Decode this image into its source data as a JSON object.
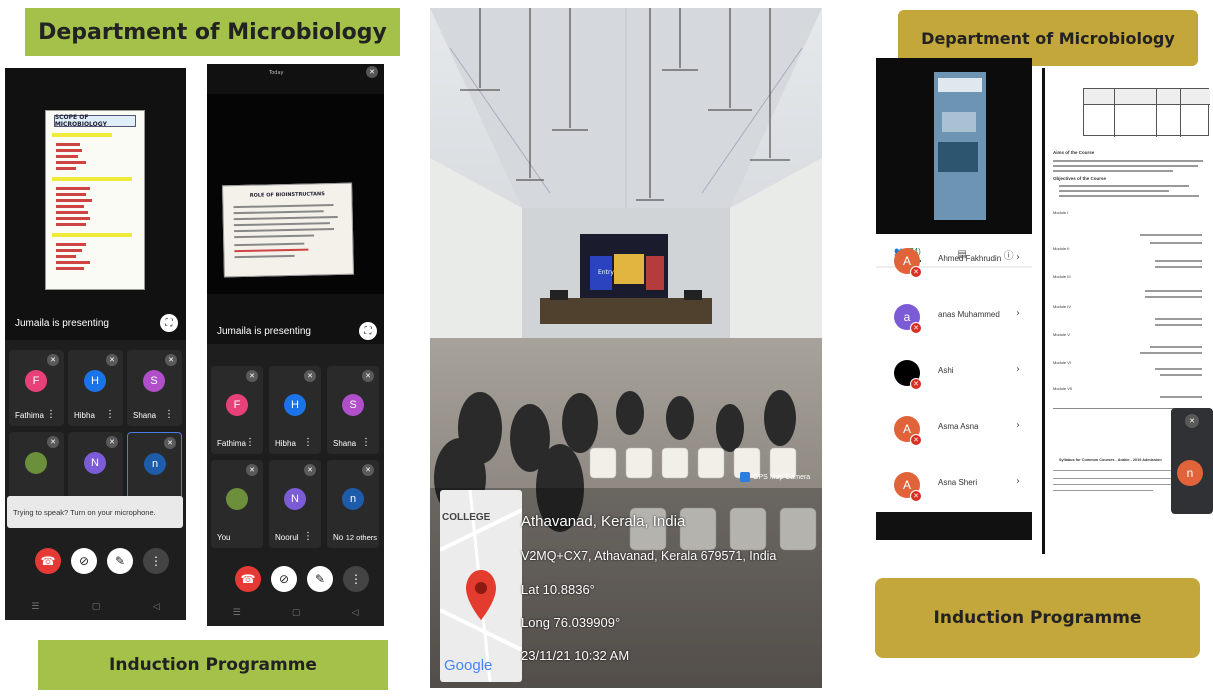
{
  "left_panel": {
    "banner_title": "Department of Microbiology",
    "footer_title": "Induction Programme",
    "colors": {
      "banner": "#a4c14a",
      "footer": "#a4c14a"
    },
    "phone_a": {
      "slide_title": "SCOPE OF MICROBIOLOGY",
      "presenting": "Jumaila is presenting",
      "tiles": [
        {
          "initial": "F",
          "name": "Fathima",
          "color": "#e8417a"
        },
        {
          "initial": "H",
          "name": "Hibha",
          "color": "#1a73e8"
        },
        {
          "initial": "S",
          "name": "Shana",
          "color": "#b04fc9"
        },
        {
          "initial": "",
          "name": "",
          "color": "#6b8f3a"
        },
        {
          "initial": "N",
          "name": "",
          "color": "#7b5cd6"
        },
        {
          "initial": "n",
          "name": "",
          "color": "#1e5ba8"
        }
      ],
      "toast": "Trying to speak? Turn on your microphone."
    },
    "phone_b": {
      "top_label": "Today",
      "slide_title": "ROLE OF BIOINSTRUCTANS",
      "presenting": "Jumaila is presenting",
      "tiles": [
        {
          "initial": "F",
          "name": "Fathima",
          "color": "#e8417a"
        },
        {
          "initial": "H",
          "name": "Hibha",
          "color": "#1a73e8"
        },
        {
          "initial": "S",
          "name": "Shana",
          "color": "#b04fc9"
        },
        {
          "initial": "",
          "name": "You",
          "color": "#6b8f3a"
        },
        {
          "initial": "N",
          "name": "Noorul",
          "color": "#7b5cd6"
        },
        {
          "initial": "n",
          "name": "No",
          "color": "#1e5ba8"
        }
      ],
      "others_label": "12 others"
    }
  },
  "middle_panel": {
    "stage_banner": "Entry",
    "gps_label": "GPS Map Camera",
    "map_label": "COLLEGE",
    "google_label": "Google",
    "location_title": "Athavanad, Kerala, India",
    "address": "V2MQ+CX7, Athavanad, Kerala 679571, India",
    "lat": "Lat 10.8836°",
    "long": "Long 76.039909°",
    "datetime": "23/11/21 10:32 AM"
  },
  "right_panel": {
    "banner_title": "Department of Microbiology",
    "footer_title": "Induction Programme",
    "colors": {
      "banner": "#c4a73a",
      "footer": "#c4a73a"
    },
    "participants_count": "(74)",
    "participants": [
      {
        "initial": "A",
        "name": "Ahmed Fakhrudin",
        "color": "#e0633a"
      },
      {
        "initial": "a",
        "name": "anas Muhammed",
        "color": "#7b5cd6"
      },
      {
        "initial": "",
        "name": "Ashi",
        "color": "#000000"
      },
      {
        "initial": "A",
        "name": "Asma Asna",
        "color": "#e0633a"
      },
      {
        "initial": "A",
        "name": "Asna Sheri",
        "color": "#e0633a"
      }
    ],
    "doc_aims_title": "Aims of the Course",
    "doc_objectives": "Objectives of the Course",
    "doc_module_labels": [
      "Module I",
      "Module II",
      "Module III",
      "Module IV",
      "Module V",
      "Module VI",
      "Module VII"
    ],
    "doc_syllabus": "Syllabus for Common Courses - Arabic - 2019 Admission",
    "floating_initial": "n"
  }
}
